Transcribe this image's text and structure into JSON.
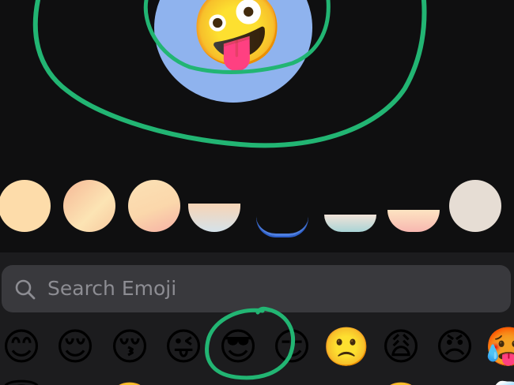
{
  "avatar": {
    "emoji": "🤪",
    "bubble_color": "#8fb3ee"
  },
  "skin_tones": {
    "colors": [
      "#fddcaa",
      "#f9c8a0",
      "#fbd7ab",
      "#f6d3b5",
      "#9ab3e0",
      "#d9e8ec",
      "#f7c3b0",
      "#e6ddd4"
    ]
  },
  "search": {
    "placeholder": "Search Emoji"
  },
  "emoji_row": [
    {
      "name": "emoji-smiling-face",
      "glyph": "😊"
    },
    {
      "name": "emoji-relieved-face",
      "glyph": "😌"
    },
    {
      "name": "emoji-kissing-face",
      "glyph": "😚"
    },
    {
      "name": "emoji-winking-tongue-face",
      "glyph": "😜"
    },
    {
      "name": "emoji-sunglasses-face",
      "glyph": "😎"
    },
    {
      "name": "emoji-smirking-face",
      "glyph": "😏"
    },
    {
      "name": "emoji-slightly-frowning-face",
      "glyph": "🙁"
    },
    {
      "name": "emoji-weary-face",
      "glyph": "😩"
    },
    {
      "name": "emoji-angry-face",
      "glyph": "😠"
    },
    {
      "name": "emoji-hot-face",
      "glyph": "🥵"
    }
  ],
  "annotation_color": "#22b573"
}
